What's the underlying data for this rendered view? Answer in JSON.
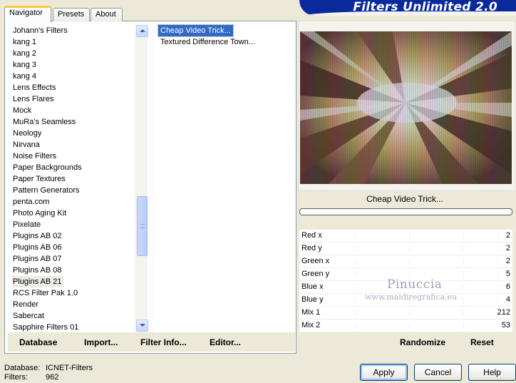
{
  "banner": {
    "title": "Filters Unlimited 2.0"
  },
  "tabs": [
    {
      "label": "Navigator",
      "active": true
    },
    {
      "label": "Presets",
      "active": false
    },
    {
      "label": "About",
      "active": false
    }
  ],
  "categories": {
    "items": [
      "Johann's Filters",
      "kang 1",
      "kang 2",
      "kang 3",
      "kang 4",
      "Lens Effects",
      "Lens Flares",
      "Mock",
      "MuRa's Seamless",
      "Neology",
      "Nirvana",
      "Noise Filters",
      "Paper Backgrounds",
      "Paper Textures",
      "Pattern Generators",
      "penta.com",
      "Photo Aging Kit",
      "Pixelate",
      "Plugins AB 02",
      "Plugins AB 06",
      "Plugins AB 07",
      "Plugins AB 08",
      "Plugins AB 21",
      "RCS Filter Pak 1.0",
      "Render",
      "Sabercat",
      "Sapphire Filters 01"
    ],
    "selected": "Plugins AB 21"
  },
  "filters": {
    "items": [
      "Cheap Video Trick...",
      "Textured Difference Town..."
    ],
    "selected": "Cheap Video Trick..."
  },
  "panel_buttons": {
    "database": "Database",
    "import": "Import...",
    "filter_info": "Filter Info...",
    "editor": "Editor..."
  },
  "preview": {
    "filter_name": "Cheap Video Trick..."
  },
  "params": [
    {
      "label": "Red x",
      "value": "2"
    },
    {
      "label": "Red y",
      "value": "2"
    },
    {
      "label": "Green x",
      "value": "2"
    },
    {
      "label": "Green y",
      "value": "5"
    },
    {
      "label": "Blue x",
      "value": "6"
    },
    {
      "label": "Blue y",
      "value": "4"
    },
    {
      "label": "Mix 1",
      "value": "212"
    },
    {
      "label": "Mix 2",
      "value": "53"
    }
  ],
  "param_buttons": {
    "randomize": "Randomize",
    "reset": "Reset"
  },
  "watermark": {
    "name": "Pinuccia",
    "url": "www.maidiregrafica.eu"
  },
  "status": {
    "database_label": "Database:",
    "database_value": "ICNET-Filters",
    "filters_label": "Filters:",
    "filters_value": "962"
  },
  "dialog_buttons": {
    "apply": "Apply",
    "cancel": "Cancel",
    "help": "Help"
  },
  "colors": {
    "banner": "#0A2A9C",
    "selection": "#316AC5",
    "tab_highlight": "#FFC83C"
  }
}
